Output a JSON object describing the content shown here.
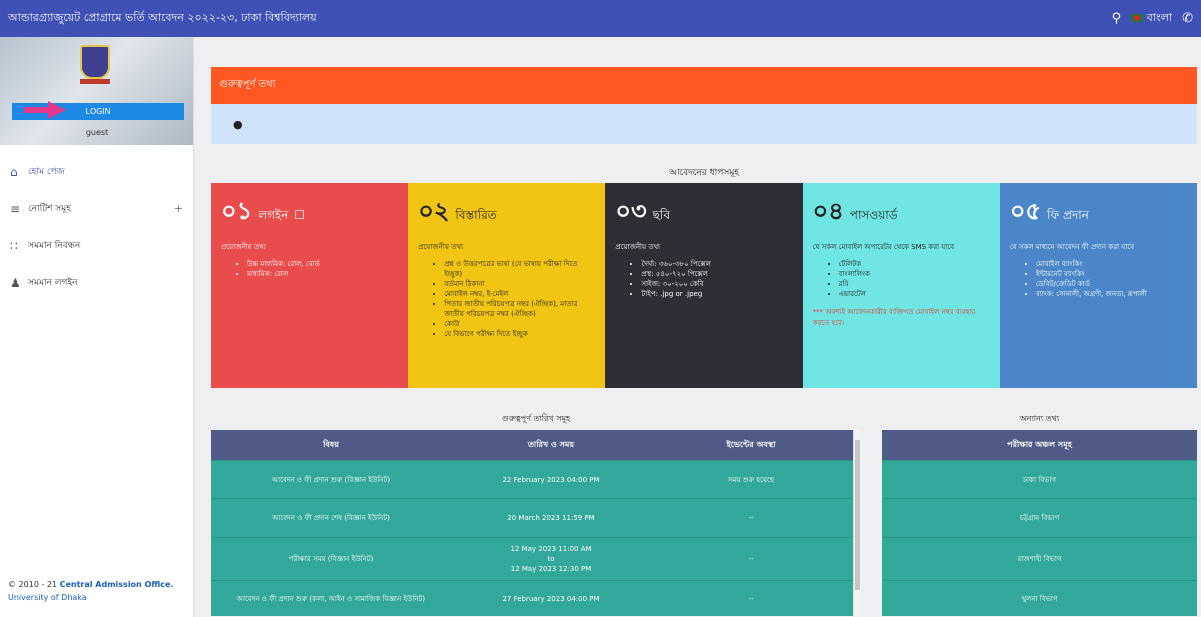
{
  "topbar": {
    "title": "আন্ডারগ্র্যাজুয়েট প্রোগ্রামে ভর্তি আবেদন ২০২২-২৩, ঢাকা বিশ্ববিদ্যালয়",
    "language": "বাংলা",
    "colors": {
      "bar": "#3f51b5"
    }
  },
  "sidebar": {
    "login_label": "LOGIN",
    "user": "guest",
    "items": [
      {
        "label": "হোম পেজ",
        "icon": "home-icon"
      },
      {
        "label": "নোটিশ সমূহ",
        "icon": "notes-icon",
        "expand": "+"
      },
      {
        "label": "সমমান নিবন্ধন",
        "icon": "register-icon"
      },
      {
        "label": "সমমান লগইন",
        "icon": "person-icon"
      }
    ],
    "copyright_prefix": "© 2010 - 21",
    "copyright_org": "Central Admission Office.",
    "copyright_uni": "University of Dhaka"
  },
  "notice": {
    "title": "গুরুত্বপূর্ণ তথ্য",
    "bullet": "●"
  },
  "steps": {
    "title": "আবেদনের ধাপসমূহ",
    "items": [
      {
        "num": "০১",
        "heading": "লগইন",
        "sub": "প্রয়োজনীয় তথ্য",
        "list": [
          "উচ্চ মাধ্যমিক: রোল, বোর্ড",
          "মাধ্যমিক: রোল"
        ]
      },
      {
        "num": "০২",
        "heading": "বিস্তারিত",
        "sub": "প্রয়োজনীয় তথ্য",
        "list": [
          "প্রশ্ন ও উত্তরপত্রের ভাষা (যে ভাষায় পরীক্ষা দিতে ইচ্ছুক)",
          "বর্তমান ঠিকানা",
          "মোবাইল নম্বর, ই-মেইল",
          "পিতার জাতীয় পরিচয়পত্র নম্বর (ঐচ্ছিক), মাতার জাতীয় পরিচয়পত্র নম্বর (ঐচ্ছিক)",
          "কোটা",
          "যে বিভাগে পরীক্ষা দিতে ইচ্ছুক"
        ]
      },
      {
        "num": "০৩",
        "heading": "ছবি",
        "sub": "প্রয়োজনীয় তথ্য",
        "list": [
          "দৈর্ঘ্য: ৩৬০-৩৮০ পিক্সেল",
          "প্রস্থ: ৫৪০-৭২০ পিক্সেল",
          "সাইজ: ৩০-২০০ কেবি",
          "টাইপ: .jpg or .jpeg"
        ]
      },
      {
        "num": "০৪",
        "heading": "পাসওয়ার্ড",
        "sub": "যে সকল মোবাইল অপারেটর থেকে SMS করা যাবে",
        "list": [
          "টেলিটক",
          "বাংলালিংক",
          "রবি",
          "এয়ারটেল"
        ],
        "warn": "*** অবশ্যই আবেদনকারীর ব্যক্তিগত মোবাইল নম্বর ব্যবহার করতে হবে।"
      },
      {
        "num": "০৫",
        "heading": "ফি প্রদান",
        "sub": "যে সকল মাধ্যমে আবেদন ফী প্রদান করা যাবে",
        "list": [
          "মোবাইল ব্যাংকিং",
          "ইন্টারনেট ব্যাংকিং",
          "ডেবিট/ক্রেডিট কার্ড",
          "ব্যাংক: সোনালী, অগ্রণী, জনতা, রূপালী"
        ]
      }
    ]
  },
  "dates": {
    "title": "গুরুত্বপূর্ণ তারিখ সমূহ",
    "headers": [
      "বিষয়",
      "তারিখ ও সময়",
      "ইভেন্টের অবস্থা"
    ],
    "rows": [
      {
        "subject": "আবেদন ও ফী প্রদান শুরু (বিজ্ঞান ইউনিট)",
        "date": "22 February 2023 04:00 PM",
        "status": "সময় শুরু হয়েছে"
      },
      {
        "subject": "আবেদন ও ফী প্রদান শেষ (বিজ্ঞান ইউনিট)",
        "date": "20 March 2023 11:59 PM",
        "status": "--"
      },
      {
        "subject": "পরীক্ষার সময় (বিজ্ঞান ইউনিট)",
        "date_start": "12 May 2023 11:00 AM",
        "date_to": "to",
        "date_end": "12 May 2023 12:30 PM",
        "status": "--"
      },
      {
        "subject": "আবেদন ও ফী প্রদান শুরু (কলা, আইন ও সামাজিক বিজ্ঞান ইউনিট)",
        "date": "27 February 2023 04:00 PM",
        "status": "--"
      }
    ]
  },
  "other": {
    "title": "অন্যান্য তথ্য",
    "header": "পরীক্ষার অঞ্চল সমূহ",
    "rows": [
      "ঢাকা বিভাগ",
      "চট্টগ্রাম বিভাগ",
      "রাজশাহী বিভাগ",
      "খুলনা বিভাগ"
    ]
  }
}
